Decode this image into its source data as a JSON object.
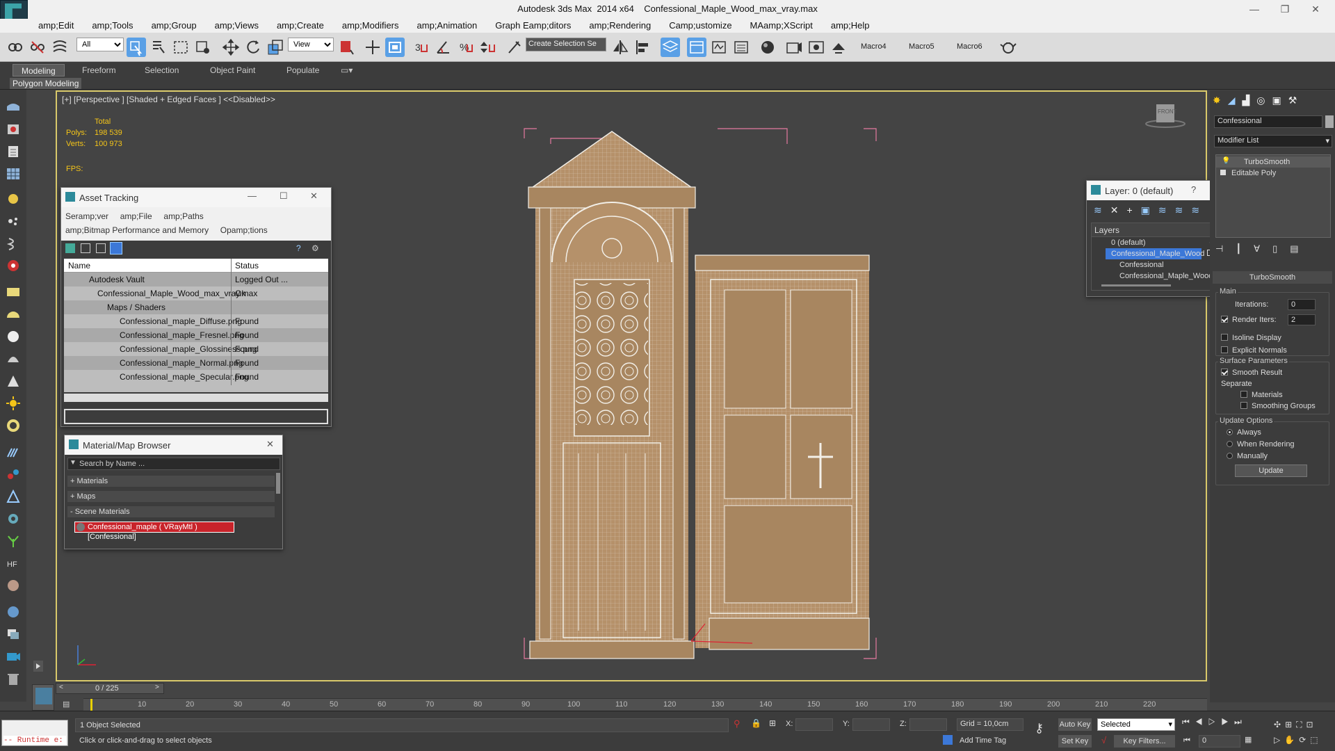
{
  "window": {
    "app": "Autodesk 3ds Max  2014 x64",
    "file": "Confessional_Maple_Wood_max_vray.max"
  },
  "menus": [
    "amp;Edit",
    "amp;Tools",
    "amp;Group",
    "amp;Views",
    "amp;Create",
    "amp;Modifiers",
    "amp;Animation",
    "Graph Eamp;ditors",
    "amp;Rendering",
    "Camp;ustomize",
    "MAamp;XScript",
    "amp;Help"
  ],
  "toolbar": {
    "selection_filter": "All",
    "ref_coord": "View",
    "named_selection": "Create Selection Se",
    "macros": [
      "Macro4",
      "Macro5",
      "Macro6"
    ]
  },
  "ribbon": {
    "tabs": [
      "Modeling",
      "Freeform",
      "Selection",
      "Object Paint",
      "Populate"
    ],
    "active": "Modeling",
    "panel_label": "Polygon Modeling"
  },
  "viewport": {
    "label": "[+] [Perspective ] [Shaded + Edged Faces ]  <<Disabled>>",
    "stats": {
      "total_label": "Total",
      "polys_label": "Polys:",
      "polys": "198 539",
      "verts_label": "Verts:",
      "verts": "100 973",
      "fps_label": "FPS:"
    },
    "viewcube_label": "FRONT"
  },
  "asset_tracking": {
    "title": "Asset Tracking",
    "menu1": [
      "Seramp;ver",
      "amp;File",
      "amp;Paths"
    ],
    "menu2": [
      "amp;Bitmap Performance and Memory",
      "Opamp;tions"
    ],
    "columns": [
      "Name",
      "Status"
    ],
    "rows": [
      {
        "name": "Autodesk Vault",
        "status": "Logged Out ..."
      },
      {
        "name": "Confessional_Maple_Wood_max_vray.max",
        "status": "Ok"
      },
      {
        "name": "Maps / Shaders",
        "status": ""
      },
      {
        "name": "Confessional_maple_Diffuse.png",
        "status": "Found"
      },
      {
        "name": "Confessional_maple_Fresnel.png",
        "status": "Found"
      },
      {
        "name": "Confessional_maple_Glossiness.png",
        "status": "Found"
      },
      {
        "name": "Confessional_maple_Normal.png",
        "status": "Found"
      },
      {
        "name": "Confessional_maple_Specular.png",
        "status": "Found"
      }
    ]
  },
  "material_browser": {
    "title": "Material/Map Browser",
    "search_placeholder": "Search by Name ...",
    "sections": [
      "+ Materials",
      "+ Maps",
      "- Scene Materials"
    ],
    "scene_material": "Confessional_maple  ( VRayMtl ) [Confessional]"
  },
  "layer_dialog": {
    "title": "Layer: 0 (default)",
    "header": "Layers",
    "items": [
      "0 (default)",
      "Confessional_Maple_Wood",
      "Confessional",
      "Confessional_Maple_Wood"
    ]
  },
  "command_panel": {
    "object_name": "Confessional",
    "modifier_list": "Modifier List",
    "stack": [
      "TurboSmooth",
      "Editable Poly"
    ],
    "rollout": "TurboSmooth",
    "main": "Main",
    "iterations_label": "Iterations:",
    "iterations": "0",
    "render_iters_label": "Render Iters:",
    "render_iters": "2",
    "isoline": "Isoline Display",
    "explicit": "Explicit Normals",
    "surface": "Surface Parameters",
    "smooth": "Smooth Result",
    "separate": "Separate",
    "materials": "Materials",
    "smoothing": "Smoothing Groups",
    "update_opts": "Update Options",
    "always": "Always",
    "when_rendering": "When Rendering",
    "manually": "Manually",
    "update_btn": "Update"
  },
  "timeline": {
    "frame": "0 / 225",
    "ticks": [
      "10",
      "20",
      "30",
      "40",
      "50",
      "60",
      "70",
      "80",
      "90",
      "100",
      "110",
      "120",
      "130",
      "140",
      "150",
      "160",
      "170",
      "180",
      "190",
      "200",
      "210",
      "220"
    ]
  },
  "status": {
    "runtime": "-- Runtime e:",
    "selected": "1 Object Selected",
    "prompt": "Click or click-and-drag to select objects",
    "x": "X:",
    "y": "Y:",
    "z": "Z:",
    "grid": "Grid = 10,0cm",
    "add_time_tag": "Add Time Tag",
    "auto_key": "Auto Key",
    "set_key": "Set Key",
    "key_mode": "Selected",
    "key_filters": "Key Filters...",
    "frame_field": "0"
  },
  "colors": {
    "wood": "#b5916a",
    "wire": "#f2efe8",
    "select_red": "#c8232a",
    "highlight": "#3c78d8"
  }
}
